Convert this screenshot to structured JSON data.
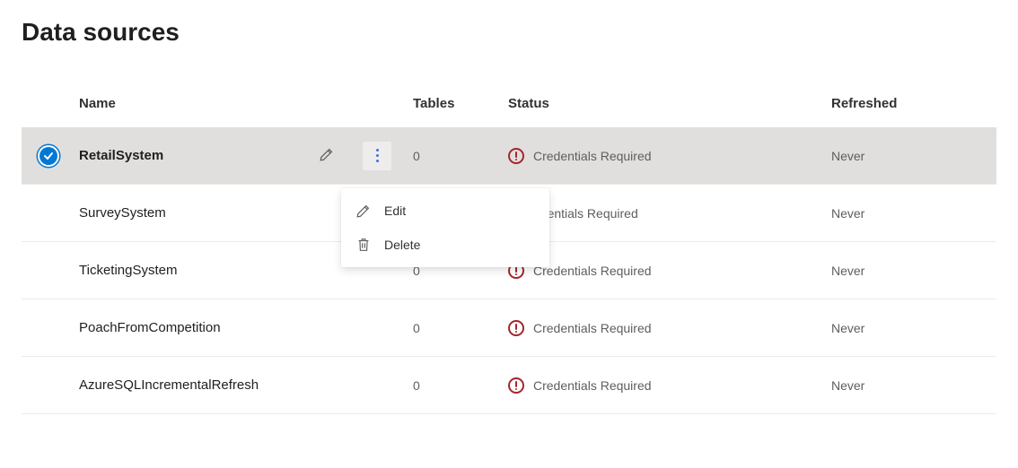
{
  "page": {
    "title": "Data sources"
  },
  "columns": {
    "name": "Name",
    "tables": "Tables",
    "status": "Status",
    "refreshed": "Refreshed"
  },
  "rows": [
    {
      "selected": true,
      "name": "RetailSystem",
      "tables": "0",
      "status": "Credentials Required",
      "refreshed": "Never",
      "showActions": true
    },
    {
      "selected": false,
      "name": "SurveySystem",
      "tables": "",
      "status": "edentials Required",
      "refreshed": "Never",
      "showActions": false
    },
    {
      "selected": false,
      "name": "TicketingSystem",
      "tables": "0",
      "status": "Credentials Required",
      "refreshed": "Never",
      "showActions": false
    },
    {
      "selected": false,
      "name": "PoachFromCompetition",
      "tables": "0",
      "status": "Credentials Required",
      "refreshed": "Never",
      "showActions": false
    },
    {
      "selected": false,
      "name": "AzureSQLIncrementalRefresh",
      "tables": "0",
      "status": "Credentials Required",
      "refreshed": "Never",
      "showActions": false
    }
  ],
  "menu": {
    "edit": "Edit",
    "delete": "Delete"
  }
}
